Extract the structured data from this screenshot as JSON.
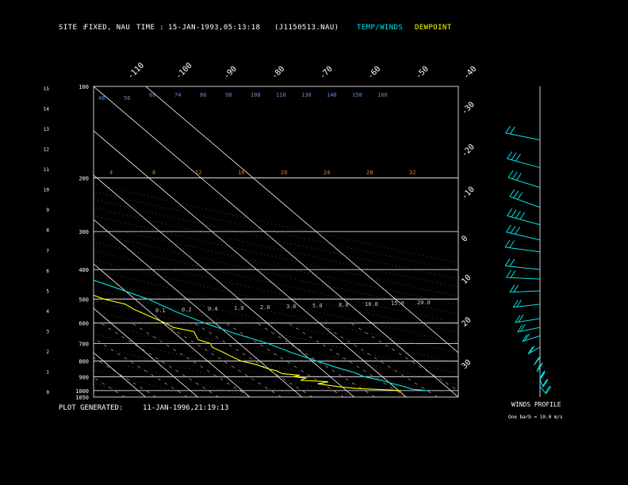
{
  "header": {
    "site_label": "SITE :",
    "site_value": "FIXED, NAU",
    "time_label": "TIME :",
    "time_value": "15-JAN-1993,05:13:18",
    "file_id": "(J1150513.NAU)",
    "legend_temp": "TEMP/WINDS",
    "legend_dew": "DEWPOINT"
  },
  "footer": {
    "generated_label": "PLOT GENERATED:",
    "generated_value": "11-JAN-1996,21:19:13"
  },
  "winds_panel": {
    "title": "WINDS PROFILE",
    "note": "One barb = 10.0 m/s"
  },
  "colors": {
    "background": "#000000",
    "grid": "#ffffff",
    "temperature": "#00e5e5",
    "dewpoint": "#ffff00",
    "isotherm_labels": "#ffffff",
    "moist_adiabat_labels": "#5b8fd9",
    "dry_adiabat_labels": "#d08030",
    "mixing_ratio_labels": "#c8c8c8"
  },
  "chart_data": {
    "type": "line",
    "subtype": "skew-t log-p",
    "y_scale": "log",
    "pressure_range_hPa": [
      1050,
      100
    ],
    "temperature_range_C": [
      -40,
      30
    ],
    "pressure_labels": [
      "100",
      "200",
      "300",
      "400",
      "500",
      "600",
      "700",
      "800",
      "900",
      "1000",
      "1050"
    ],
    "pressure_levels": [
      100,
      200,
      300,
      400,
      500,
      600,
      700,
      800,
      900,
      1000,
      1050
    ],
    "isobars_drawn": [
      200,
      300,
      400,
      500,
      600,
      700,
      800,
      900,
      1000
    ],
    "height_labels": [
      "15",
      "14",
      "13",
      "12",
      "11",
      "10",
      "9",
      "8",
      "7",
      "6",
      "5",
      "4",
      "3",
      "2",
      "1",
      "0"
    ],
    "isotherm_top_labels": [
      "-110",
      "-100",
      "-90",
      "-80",
      "-70",
      "-60",
      "-50",
      "-40"
    ],
    "isotherm_right_labels": [
      "-30",
      "-20",
      "-10",
      "0",
      "10",
      "20",
      "30"
    ],
    "moist_adiabat_labels_top": [
      "48",
      "56",
      "60",
      "74",
      "86",
      "98",
      "108",
      "118",
      "130",
      "140",
      "150",
      "160"
    ],
    "dry_adiabat_labels_mid": [
      "4",
      "8",
      "12",
      "16",
      "20",
      "24",
      "28",
      "32"
    ],
    "mixing_ratio_labels": [
      "0.1",
      "0.2",
      "0.4",
      "1.0",
      "2.0",
      "3.0",
      "5.0",
      "8.0",
      "10.0",
      "15.0",
      "20.0"
    ],
    "series": [
      {
        "name": "TEMP/WINDS",
        "points": [
          [
            1000,
            25.5
          ],
          [
            990,
            23.0
          ],
          [
            970,
            22.0
          ],
          [
            950,
            20.5
          ],
          [
            925,
            19.0
          ],
          [
            900,
            16.5
          ],
          [
            870,
            15.5
          ],
          [
            850,
            14.0
          ],
          [
            800,
            11.0
          ],
          [
            750,
            8.0
          ],
          [
            700,
            5.5
          ],
          [
            650,
            1.5
          ],
          [
            600,
            -2.0
          ],
          [
            550,
            -5.0
          ],
          [
            500,
            -7.5
          ],
          [
            450,
            -12.0
          ],
          [
            400,
            -17.5
          ],
          [
            370,
            -21.0
          ],
          [
            350,
            -24.0
          ],
          [
            330,
            -27.0
          ],
          [
            300,
            -31.0
          ],
          [
            270,
            -34.5
          ],
          [
            250,
            -37.0
          ],
          [
            230,
            -41.0
          ],
          [
            220,
            -42.5
          ],
          [
            210,
            -44.5
          ],
          [
            200,
            -46.5
          ],
          [
            180,
            -48.5
          ],
          [
            160,
            -53.0
          ],
          [
            145,
            -56.5
          ],
          [
            130,
            -59.0
          ],
          [
            120,
            -61.0
          ],
          [
            110,
            -63.0
          ],
          [
            100,
            -64.0
          ]
        ]
      },
      {
        "name": "DEWPOINT",
        "points": [
          [
            1000,
            20.5
          ],
          [
            995,
            18.5
          ],
          [
            985,
            12.5
          ],
          [
            975,
            10.0
          ],
          [
            950,
            6.0
          ],
          [
            935,
            8.5
          ],
          [
            925,
            3.5
          ],
          [
            910,
            5.0
          ],
          [
            900,
            3.0
          ],
          [
            890,
            4.5
          ],
          [
            880,
            1.5
          ],
          [
            860,
            1.0
          ],
          [
            850,
            0.0
          ],
          [
            820,
            -1.5
          ],
          [
            800,
            -3.5
          ],
          [
            770,
            -4.5
          ],
          [
            750,
            -5.0
          ],
          [
            720,
            -6.0
          ],
          [
            700,
            -5.5
          ],
          [
            680,
            -7.0
          ],
          [
            660,
            -6.5
          ],
          [
            640,
            -6.0
          ],
          [
            620,
            -9.0
          ],
          [
            600,
            -9.5
          ],
          [
            580,
            -10.5
          ],
          [
            560,
            -11.5
          ],
          [
            540,
            -12.5
          ],
          [
            520,
            -13.0
          ],
          [
            500,
            -16.0
          ],
          [
            480,
            -17.5
          ],
          [
            460,
            -20.0
          ],
          [
            430,
            -22.0
          ],
          [
            410,
            -23.5
          ],
          [
            400,
            -25.0
          ],
          [
            380,
            -26.5
          ],
          [
            370,
            -28.5
          ],
          [
            350,
            -32.0
          ],
          [
            330,
            -34.0
          ],
          [
            320,
            -36.5
          ],
          [
            300,
            -38.5
          ],
          [
            280,
            -44.0
          ],
          [
            265,
            -47.5
          ],
          [
            255,
            -50.5
          ],
          [
            245,
            -54.0
          ],
          [
            230,
            -58.5
          ],
          [
            215,
            -61.0
          ],
          [
            205,
            -64.0
          ],
          [
            195,
            -66.5
          ],
          [
            175,
            -71.5
          ],
          [
            160,
            -72.5
          ],
          [
            150,
            -73.5
          ],
          [
            140,
            -74.0
          ],
          [
            130,
            -75.0
          ],
          [
            120,
            -75.5
          ],
          [
            110,
            -75.0
          ],
          [
            100,
            -76.0
          ]
        ]
      }
    ],
    "winds_profile": [
      {
        "p": 150,
        "spd_ms": 15,
        "dir": 280
      },
      {
        "p": 185,
        "spd_ms": 25,
        "dir": 290
      },
      {
        "p": 215,
        "spd_ms": 30,
        "dir": 295
      },
      {
        "p": 250,
        "spd_ms": 30,
        "dir": 300
      },
      {
        "p": 285,
        "spd_ms": 35,
        "dir": 290
      },
      {
        "p": 320,
        "spd_ms": 25,
        "dir": 285
      },
      {
        "p": 350,
        "spd_ms": 20,
        "dir": 270
      },
      {
        "p": 400,
        "spd_ms": 20,
        "dir": 265
      },
      {
        "p": 430,
        "spd_ms": 15,
        "dir": 255
      },
      {
        "p": 470,
        "spd_ms": 15,
        "dir": 240
      },
      {
        "p": 520,
        "spd_ms": 15,
        "dir": 230
      },
      {
        "p": 580,
        "spd_ms": 20,
        "dir": 225
      },
      {
        "p": 620,
        "spd_ms": 20,
        "dir": 220
      },
      {
        "p": 660,
        "spd_ms": 15,
        "dir": 210
      },
      {
        "p": 720,
        "spd_ms": 20,
        "dir": 200
      },
      {
        "p": 780,
        "spd_ms": 20,
        "dir": 190
      },
      {
        "p": 820,
        "spd_ms": 25,
        "dir": 185
      },
      {
        "p": 870,
        "spd_ms": 25,
        "dir": 180
      },
      {
        "p": 920,
        "spd_ms": 20,
        "dir": 175
      },
      {
        "p": 970,
        "spd_ms": 20,
        "dir": 170
      }
    ]
  }
}
